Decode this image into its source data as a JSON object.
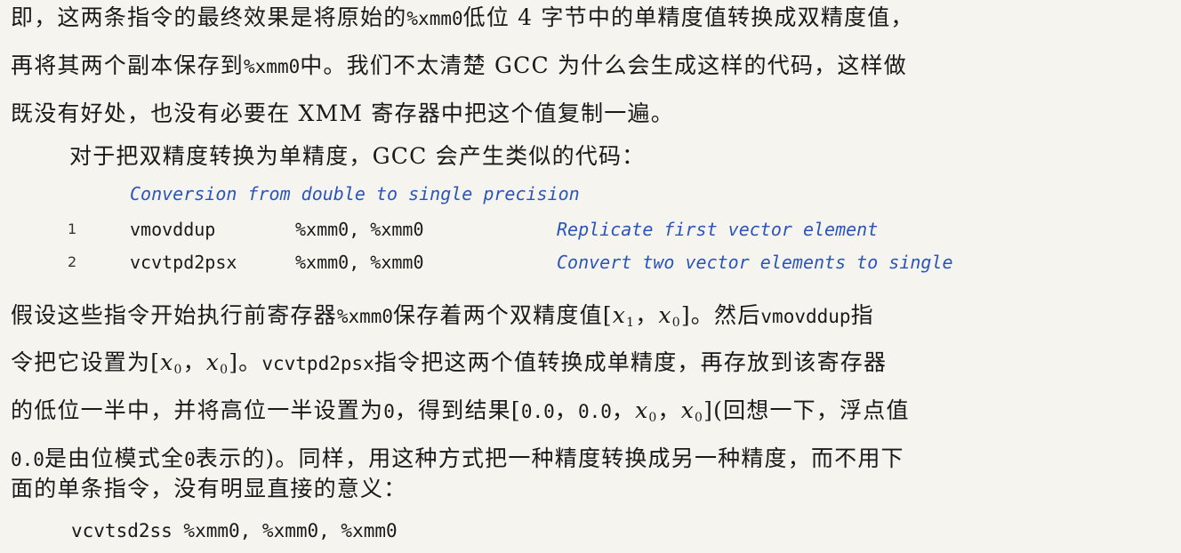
{
  "para1": {
    "l1_a": "即，这两条指令的最终效果是将原始的",
    "l1_code": "%xmm0",
    "l1_b": "低位 4 字节中的单精度值转换成双精度值，",
    "l2_a": "再将其两个副本保存到",
    "l2_code": "%xmm0",
    "l2_b": "中。我们不太清楚 GCC 为什么会生成这样的代码，这样做",
    "l3": "既没有好处，也没有必要在 XMM 寄存器中把这个值复制一遍。"
  },
  "para2": {
    "l1": "对于把双精度转换为单精度，GCC 会产生类似的代码："
  },
  "code": {
    "header": "Conversion from double to single precision",
    "rows": [
      {
        "num": "1",
        "op": "vmovddup",
        "args": "%xmm0, %xmm0",
        "comment": "Replicate first vector element"
      },
      {
        "num": "2",
        "op": "vcvtpd2psx",
        "args": "%xmm0, %xmm0",
        "comment": "Convert two vector elements to single"
      }
    ]
  },
  "para3": {
    "l1_a": "假设这些指令开始执行前寄存器",
    "l1_code": "%xmm0",
    "l1_b": "保存着两个双精度值[",
    "l1_x1": "x",
    "l1_x1_sub": "1",
    "l1_sep": "，",
    "l1_x0": "x",
    "l1_x0_sub": "0",
    "l1_c": "]。然后",
    "l1_code2": "vmovddup",
    "l1_d": "指",
    "l2_a": "令把它设置为[",
    "l2_x0a": "x",
    "l2_x0a_sub": "0",
    "l2_sep": "，",
    "l2_x0b": "x",
    "l2_x0b_sub": "0",
    "l2_b": "]。",
    "l2_code": "vcvtpd2psx",
    "l2_c": "指令把这两个值转换成单精度，再存放到该寄存器",
    "l3_a": "的低位一半中，并将高位一半设置为",
    "l3_zero": "0",
    "l3_b": "，得到结果[",
    "l3_v1": "0.0",
    "l3_sep1": "，",
    "l3_v2": "0.0",
    "l3_sep2": "，",
    "l3_x0a": "x",
    "l3_x0a_sub": "0",
    "l3_sep3": "，",
    "l3_x0b": "x",
    "l3_x0b_sub": "0",
    "l3_c": "](回想一下，浮点值",
    "l4_v": "0.0",
    "l4_a": "是由位模式全",
    "l4_zero": "0",
    "l4_b": "表示的)。同样，用这种方式把一种精度转换成另一种精度，而不用下",
    "l5": "面的单条指令，没有明显直接的意义："
  },
  "final_code": "vcvtsd2ss %xmm0, %xmm0, %xmm0"
}
